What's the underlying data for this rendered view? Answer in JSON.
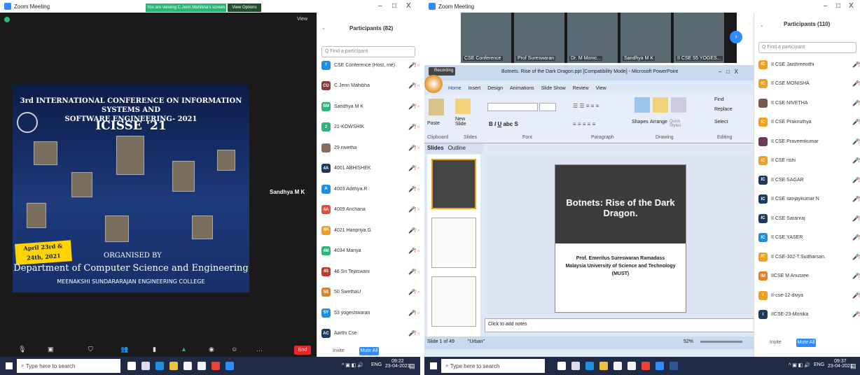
{
  "left": {
    "title": "Zoom Meeting",
    "viewing_notice": "You are viewing C.Jerin Mahibha's screen",
    "view_options": "View Options",
    "view_btn": "View",
    "active_speaker": "Sandhya M K",
    "participants_title": "Participants (82)",
    "find_placeholder": "Q Find a participant",
    "participants": [
      {
        "initials": "f",
        "name": "CSE Conference (Host, me)",
        "color": "#1a8fe3"
      },
      {
        "initials": "CU",
        "name": "C.Jerin Mahibha",
        "color": "#8a3a3a"
      },
      {
        "initials": "SM",
        "name": "Sandhya M K",
        "color": "#2bb673"
      },
      {
        "initials": "2",
        "name": "21-KOWSHIK",
        "color": "#2bb673"
      },
      {
        "initials": "",
        "name": "29 nivetha",
        "color": "#8a6a5a"
      },
      {
        "initials": "4A",
        "name": "4001 ABHISHEK",
        "color": "#1e3a5f"
      },
      {
        "initials": "A",
        "name": "4003 Adithya.R",
        "color": "#1a8fe3"
      },
      {
        "initials": "4A",
        "name": "4009 Anchana",
        "color": "#e74c3c"
      },
      {
        "initials": "4H",
        "name": "4021 Hanpriya.G",
        "color": "#f0a020"
      },
      {
        "initials": "4M",
        "name": "4034 Manya",
        "color": "#2bb673"
      },
      {
        "initials": "4S",
        "name": "46 Sri Tejaswani",
        "color": "#c0392b"
      },
      {
        "initials": "5S",
        "name": "50 SwethaU",
        "color": "#e67e22"
      },
      {
        "initials": "5Y",
        "name": "53 yogeshwaran",
        "color": "#1a8fe3"
      },
      {
        "initials": "AC",
        "name": "Aarthi Cse",
        "color": "#1e3a5f"
      }
    ],
    "invite": "Invite",
    "mute_all": "Mute All",
    "end": "End",
    "slide": {
      "head1": "3rd INTERNATIONAL CONFERENCE ON INFORMATION SYSTEMS AND",
      "head2": "SOFTWARE ENGINEERING- 2021",
      "acronym": "ICISSE '21",
      "dates": "April 23rd & 24th, 2021",
      "organised": "ORGANISED BY",
      "dept": "Department of Computer Science and Engineering",
      "college": "MEENAKSHI SUNDARARAJAN ENGINEERING COLLEGE"
    },
    "search": "Type here to search",
    "time": "09:22",
    "date": "23-04-2021",
    "lang": "ENG"
  },
  "right": {
    "title": "Zoom Meeting",
    "videos": [
      "CSE Conference",
      "Prof Sureswaran",
      "Dr. M Monic...",
      "Sandhya M K",
      "II CSE 55 YOGES..."
    ],
    "recording": "Recording",
    "ppt_title": "Botnets. Rise of the Dark Dragon.ppt [Compatibility Mode] - Microsoft PowerPoint",
    "ribbon_tabs": [
      "Home",
      "Insert",
      "Design",
      "Animations",
      "Slide Show",
      "Review",
      "View"
    ],
    "groups": [
      "Clipboard",
      "Slides",
      "Font",
      "Paragraph",
      "Drawing",
      "Editing"
    ],
    "paste": "Paste",
    "new_slide": "New Slide",
    "shapes": "Shapes",
    "arrange": "Arrange",
    "quick_styles": "Quick Styles",
    "find": "Find",
    "replace": "Replace",
    "select": "Select",
    "pane_tabs": [
      "Slides",
      "Outline"
    ],
    "slide_title": "Botnets: Rise of the Dark Dragon.",
    "presenter": "Prof. Emeritus Sureswaran Ramadass",
    "uni": "Malaysia University of Science and Technology",
    "must": "(MUST)",
    "notes": "Click to add notes",
    "status": "Slide 1 of 49",
    "theme": "\"Urban\"",
    "zoom": "52%",
    "participants_title": "Participants (110)",
    "find_placeholder": "Q Find a participant",
    "participants": [
      {
        "initials": "IC",
        "name": "II CSE Jaishreenithi",
        "color": "#f0a020"
      },
      {
        "initials": "IC",
        "name": "II CSE MONISHA",
        "color": "#f0a020"
      },
      {
        "initials": "",
        "name": "II CSE NIVETHA",
        "color": "#7a5a4a"
      },
      {
        "initials": "IC",
        "name": "II CSE Praknuthya",
        "color": "#f0a020"
      },
      {
        "initials": "",
        "name": "II CSE Praveenkumar",
        "color": "#6a3a5a"
      },
      {
        "initials": "IC",
        "name": "II CSE rishi",
        "color": "#f0a020"
      },
      {
        "initials": "IC",
        "name": "II CSE SAGAR",
        "color": "#1e3a5f"
      },
      {
        "initials": "IC",
        "name": "II CSE sanjaykumar N",
        "color": "#1e3a5f"
      },
      {
        "initials": "IC",
        "name": "II CSE Saranraj",
        "color": "#1e3a5f"
      },
      {
        "initials": "IC",
        "name": "II CSE YASER",
        "color": "#1a8fe3"
      },
      {
        "initials": "IC",
        "name": "II CSE-302-T.Sudharsan.",
        "color": "#f0a020"
      },
      {
        "initials": "IM",
        "name": "IICSE M Anusree",
        "color": "#e67e22"
      },
      {
        "initials": "I",
        "name": "II-cse-12-divya",
        "color": "#f0a020"
      },
      {
        "initials": "I",
        "name": "IICSE-23-Monika",
        "color": "#1e3a5f"
      }
    ],
    "invite": "Invite",
    "mute_all": "Mute All",
    "search": "Type here to search",
    "time": "09:37",
    "date": "23-04-2021",
    "lang": "ENG"
  }
}
